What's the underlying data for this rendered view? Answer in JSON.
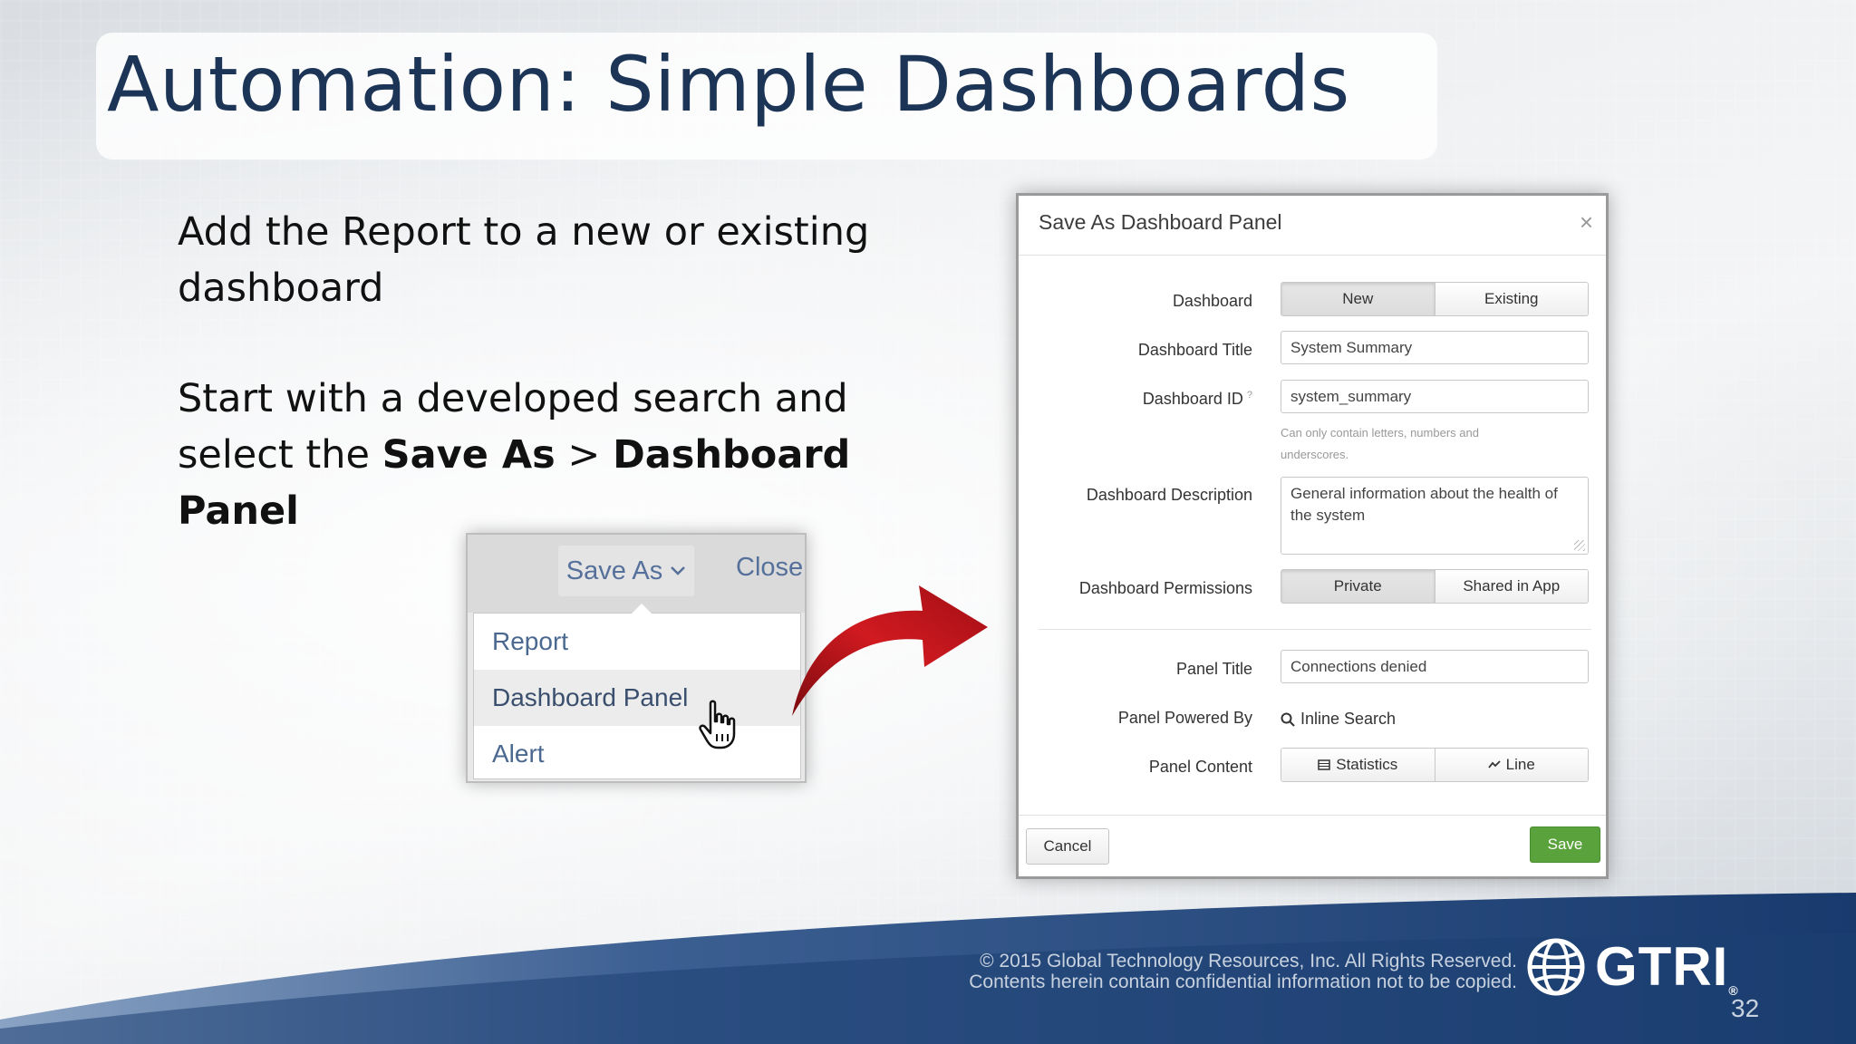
{
  "slide": {
    "title": "Automation: Simple Dashboards",
    "paragraph1": "Add the Report to a new or existing dashboard",
    "paragraph2_prefix": "Start with a developed search and select the ",
    "paragraph2_bold1": "Save As",
    "paragraph2_sep": " > ",
    "paragraph2_bold2": "Dashboard Panel",
    "page_number": "32"
  },
  "dropdown": {
    "save_as_label": "Save As",
    "close_label": "Close",
    "items": [
      "Report",
      "Dashboard Panel",
      "Alert"
    ],
    "hovered_item": "Dashboard Panel"
  },
  "dialog": {
    "title": "Save As Dashboard Panel",
    "close_glyph": "×",
    "dashboard_label": "Dashboard",
    "dashboard_options": [
      "New",
      "Existing"
    ],
    "dashboard_selected": "New",
    "dashboard_title_label": "Dashboard Title",
    "dashboard_title_value": "System Summary",
    "dashboard_id_label": "Dashboard ID",
    "dashboard_id_help_glyph": "?",
    "dashboard_id_value": "system_summary",
    "dashboard_id_help": "Can only contain letters, numbers and underscores.",
    "description_label": "Dashboard Description",
    "description_value": "General information about the health of the system",
    "permissions_label": "Dashboard Permissions",
    "permissions_options": [
      "Private",
      "Shared in App"
    ],
    "permissions_selected": "Private",
    "panel_title_label": "Panel Title",
    "panel_title_value": "Connections denied",
    "powered_by_label": "Panel Powered By",
    "powered_by_value": "Inline Search",
    "content_label": "Panel Content",
    "content_options": [
      "Statistics",
      "Line"
    ],
    "cancel_label": "Cancel",
    "save_label": "Save"
  },
  "footer": {
    "copyright_line1": "© 2015 Global Technology Resources, Inc. All Rights Reserved.",
    "copyright_line2": "Contents herein contain confidential information not to be copied.",
    "logo_text": "GTRI",
    "logo_reg": "®"
  },
  "colors": {
    "title": "#1c3557",
    "save_button": "#5aa33c",
    "arrow": "#c0151b",
    "footer_band": "#1d3f73"
  },
  "icons": [
    "search-icon",
    "table-icon",
    "line-chart-icon",
    "hand-cursor-icon",
    "globe-icon",
    "chevron-down-icon",
    "curved-arrow-icon"
  ]
}
